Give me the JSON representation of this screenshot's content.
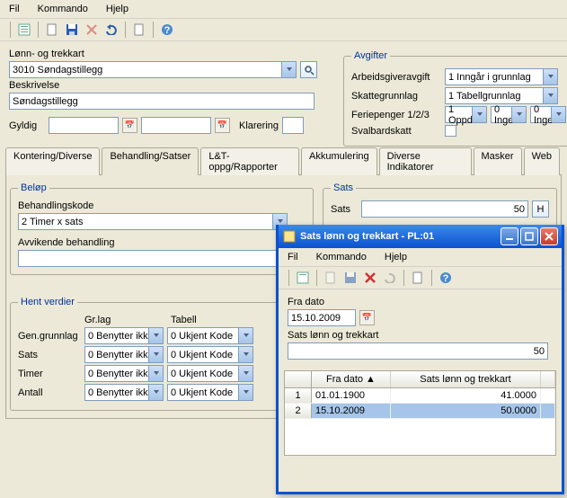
{
  "menu": {
    "fil": "Fil",
    "kommando": "Kommando",
    "hjelp": "Hjelp"
  },
  "lonn_label": "Lønn- og trekkart",
  "lonn_value": "3010 Søndagstillegg",
  "besk_label": "Beskrivelse",
  "besk_value": "Søndagstillegg",
  "gyldig_label": "Gyldig",
  "klarering_label": "Klarering",
  "avgifter": {
    "legend": "Avgifter",
    "arb_label": "Arbeidsgiveravgift",
    "arb_val": "1 Inngår i grunnlag",
    "skatt_label": "Skattegrunnlag",
    "skatt_val": "1 Tabellgrunnlag",
    "ferie_label": "Feriepenger 1/2/3",
    "f1": "1 Oppd",
    "f2": "0 Inge",
    "f3": "0 Inge",
    "sval_label": "Svalbardskatt"
  },
  "tabs": [
    "Kontering/Diverse",
    "Behandling/Satser",
    "L&T-oppg/Rapporter",
    "Akkumulering",
    "Diverse Indikatorer",
    "Masker",
    "Web"
  ],
  "active_tab": 1,
  "belop": {
    "legend": "Beløp",
    "bk_label": "Behandlingskode",
    "bk_val": "2 Timer x sats",
    "avv_label": "Avvikende behandling"
  },
  "sats": {
    "legend": "Sats",
    "label": "Sats",
    "value": "50",
    "btn": "H"
  },
  "hent": {
    "legend": "Hent verdier",
    "hdr_grlag": "Gr.lag",
    "hdr_tabell": "Tabell",
    "rows": [
      {
        "lbl": "Gen.grunnlag",
        "g": "0 Benytter ikk",
        "t": "0 Ukjent Kode"
      },
      {
        "lbl": "Sats",
        "g": "0 Benytter ikk",
        "t": "0 Ukjent Kode"
      },
      {
        "lbl": "Timer",
        "g": "0 Benytter ikk",
        "t": "0 Ukjent Kode"
      },
      {
        "lbl": "Antall",
        "g": "0 Benytter ikk",
        "t": "0 Ukjent Kode"
      }
    ]
  },
  "popup": {
    "title": "Sats lønn og trekkart - PL:01",
    "fra_label": "Fra dato",
    "fra_val": "15.10.2009",
    "slt_label": "Sats lønn og trekkart",
    "slt_val": "50",
    "col_fra": "Fra dato",
    "col_slt": "Sats lønn og trekkart",
    "rows": [
      {
        "n": "1",
        "d": "01.01.1900",
        "v": "41.0000"
      },
      {
        "n": "2",
        "d": "15.10.2009",
        "v": "50.0000"
      }
    ]
  }
}
